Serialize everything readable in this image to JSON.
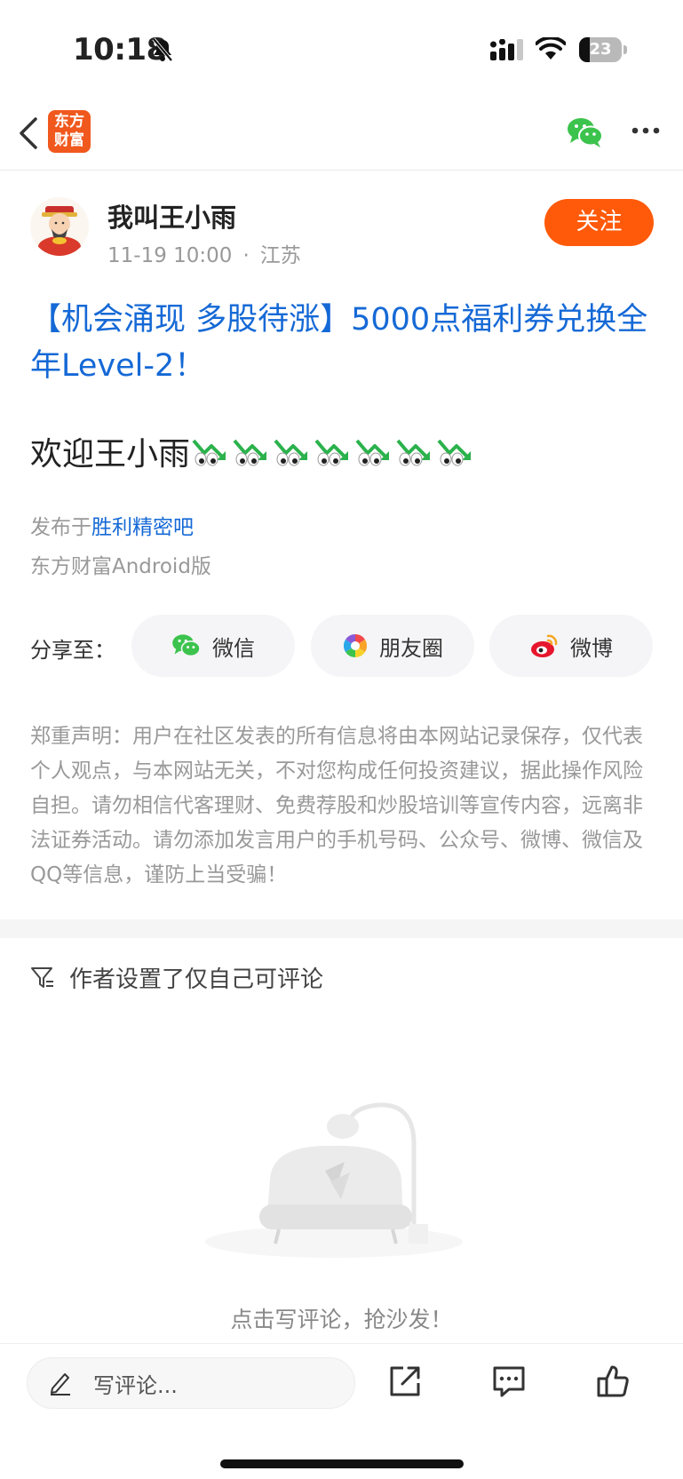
{
  "status_bar": {
    "time": "10:18",
    "battery": "23"
  },
  "nav": {
    "logo_line1": "东方",
    "logo_line2": "财富"
  },
  "author": {
    "name": "我叫王小雨",
    "date": "11-19 10:00",
    "dot": "·",
    "location": "江苏",
    "follow_label": "关注"
  },
  "post": {
    "title": "【机会涌现 多股待涨】5000点福利券兑换全年Level-2！",
    "content": "欢迎王小雨",
    "emoji_count": 7,
    "emoji_name": "eyes-down-trend-emoji",
    "posted_prefix": "发布于",
    "bar_name": "胜利精密吧",
    "client": "东方财富Android版"
  },
  "share": {
    "label": "分享至：",
    "wechat": "微信",
    "moments": "朋友圈",
    "weibo": "微博"
  },
  "disclaimer": "郑重声明：用户在社区发表的所有信息将由本网站记录保存，仅代表个人观点，与本网站无关，不对您构成任何投资建议，据此操作风险自担。请勿相信代客理财、免费荐股和炒股培训等宣传内容，远离非法证券活动。请勿添加发言用户的手机号码、公众号、微博、微信及QQ等信息，谨防上当受骗！",
  "comments": {
    "note": "作者设置了仅自己可评论",
    "empty_text": "点击写评论，抢沙发！"
  },
  "bottom_bar": {
    "input_placeholder": "写评论..."
  },
  "colors": {
    "accent_orange": "#ff5a0a",
    "link_blue": "#1569d6",
    "wechat_green": "#3cc34d"
  }
}
